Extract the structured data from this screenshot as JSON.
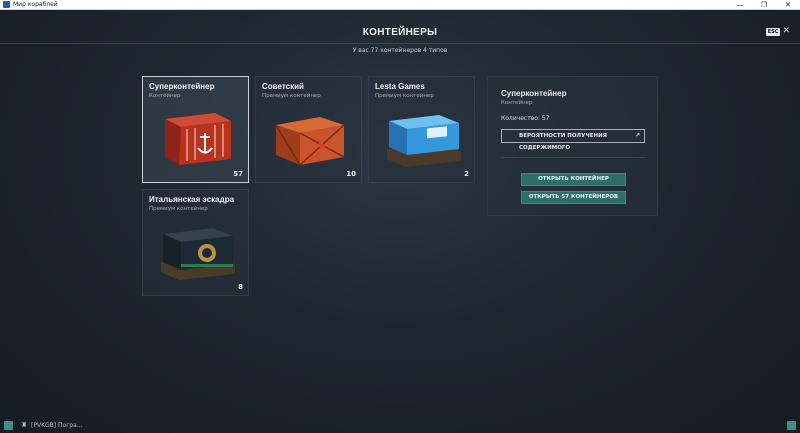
{
  "window": {
    "title": "Мир кораблей",
    "controls": {
      "minimize": "—",
      "maximize": "❐",
      "close": "✕"
    }
  },
  "header": {
    "title": "КОНТЕЙНЕРЫ",
    "subtitle": "У вас 77 контейнеров 4 типов",
    "esc_label": "ESC",
    "close_glyph": "✕"
  },
  "containers": [
    {
      "name": "Суперконтейнер",
      "type": "Контейнер",
      "count": "57",
      "selected": true,
      "color": "#c0392b",
      "icon": "anchor-crate-icon"
    },
    {
      "name": "Советский",
      "type": "Премиум контейнер",
      "count": "10",
      "selected": false,
      "color": "#c8501e",
      "icon": "soviet-crate-icon"
    },
    {
      "name": "Lesta Games",
      "type": "Премиум контейнер",
      "count": "2",
      "selected": false,
      "color": "#2f8fd6",
      "icon": "lesta-crate-icon"
    },
    {
      "name": "Итальянская эскадра",
      "type": "Премиум контейнер",
      "count": "8",
      "selected": false,
      "color": "#1e2a33",
      "icon": "italian-crate-icon"
    }
  ],
  "detail": {
    "name": "Суперконтейнер",
    "type": "Контейнер",
    "quantity": "Количество: 57",
    "probability_button": "ВЕРОЯТНОСТИ ПОЛУЧЕНИЯ СОДЕРЖИМОГО",
    "external_glyph": "↗",
    "open_one": "ОТКРЫТЬ КОНТЕЙНЕР",
    "open_all": "ОТКРЫТЬ 57 КОНТЕЙНЕРОВ"
  },
  "footer": {
    "clan_text": "[PVKGB] Погра..."
  },
  "colors": {
    "accent": "#2f6f6a",
    "background": "#1e262f"
  }
}
